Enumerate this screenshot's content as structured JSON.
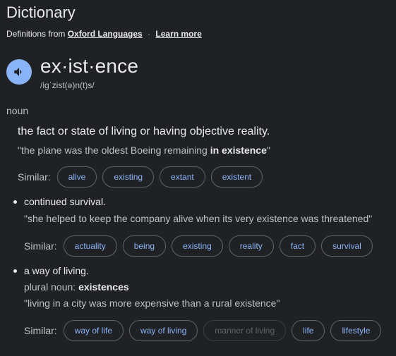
{
  "header": {
    "title": "Dictionary",
    "source_prefix": "Definitions from",
    "source_link": "Oxford Languages",
    "separator": "·",
    "learn_more": "Learn more"
  },
  "entry": {
    "headword": "ex·ist·ence",
    "phonetic": "/iɡˈzist(ə)n(t)s/",
    "part_of_speech": "noun",
    "icons": {
      "pronounce": "volume-icon"
    }
  },
  "senses": [
    {
      "definition": "the fact or state of living or having objective reality.",
      "example_pre": "\"the plane was the oldest Boeing remaining ",
      "example_bold": "in existence",
      "example_post": "\"",
      "similar_label": "Similar:",
      "similar": [
        "alive",
        "existing",
        "extant",
        "existent"
      ]
    },
    {
      "definition": "continued survival.",
      "example": "\"she helped to keep the company alive when its very existence was threatened\"",
      "similar_label": "Similar:",
      "similar": [
        "actuality",
        "being",
        "existing",
        "reality",
        "fact",
        "survival"
      ]
    },
    {
      "definition": "a way of living.",
      "plural_label": "plural noun:",
      "plural_value": "existences",
      "example": "\"living in a city was more expensive than a rural existence\"",
      "similar_label": "Similar:",
      "similar": [
        "way of life",
        "way of living",
        "manner of living",
        "life",
        "lifestyle"
      ]
    }
  ],
  "colors": {
    "background": "#202124",
    "text": "#e8eaed",
    "secondary_text": "#bdc1c6",
    "accent": "#8ab4f8",
    "chip_border": "#5f6368"
  }
}
